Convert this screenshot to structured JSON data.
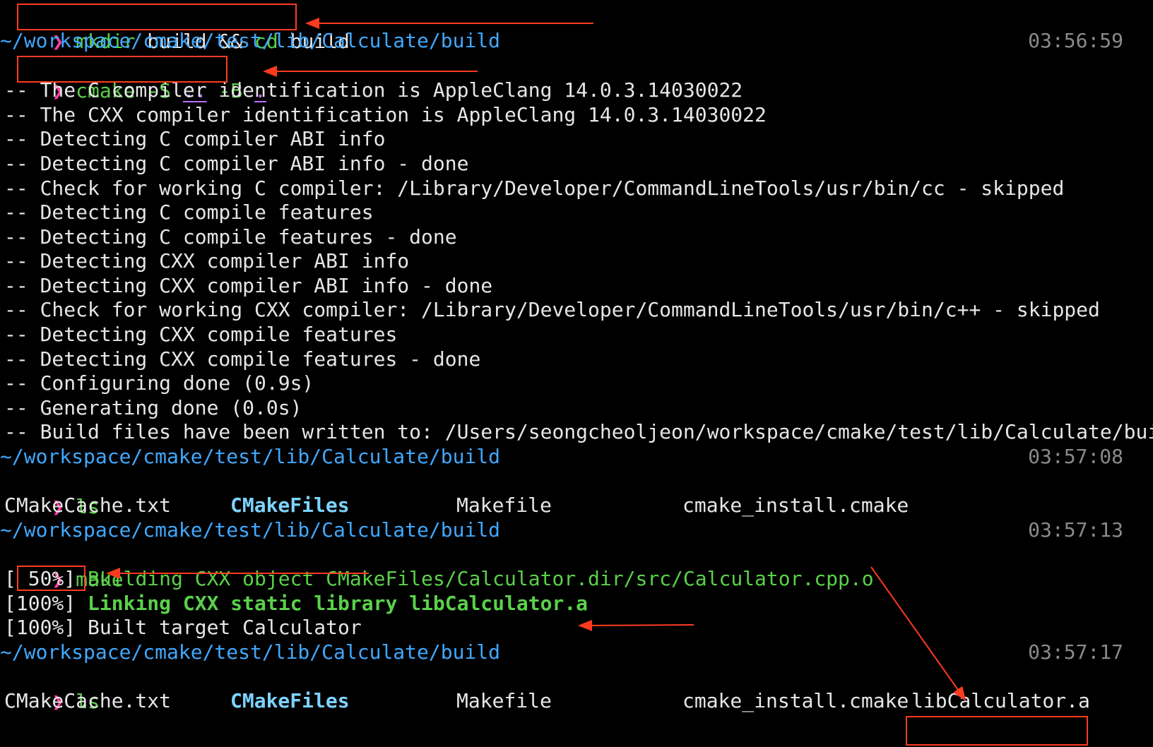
{
  "prompt_symbol": "❯",
  "path_prefix": "~/workspace/cmake/test/lib/Calculate/build",
  "cmd1": {
    "mkdir": "mkdir",
    "a1": " build ",
    "amp": "&&",
    "cd": " cd",
    "a2": " build"
  },
  "time1": "03:56:59",
  "cmd2": {
    "cmake": "cmake",
    "s": " -S ",
    "dotdot": "..",
    "b": " -B ",
    "dot": "."
  },
  "cmake_output": [
    "-- The C compiler identification is AppleClang 14.0.3.14030022",
    "-- The CXX compiler identification is AppleClang 14.0.3.14030022",
    "-- Detecting C compiler ABI info",
    "-- Detecting C compiler ABI info - done",
    "-- Check for working C compiler: /Library/Developer/CommandLineTools/usr/bin/cc - skipped",
    "-- Detecting C compile features",
    "-- Detecting C compile features - done",
    "-- Detecting CXX compiler ABI info",
    "-- Detecting CXX compiler ABI info - done",
    "-- Check for working CXX compiler: /Library/Developer/CommandLineTools/usr/bin/c++ - skipped",
    "-- Detecting CXX compile features",
    "-- Detecting CXX compile features - done",
    "-- Configuring done (0.9s)",
    "-- Generating done (0.0s)",
    "-- Build files have been written to: /Users/seongcheoljeon/workspace/cmake/test/lib/Calculate/build"
  ],
  "time2": "03:57:08",
  "cmd3": "ls",
  "ls1": [
    "CMakeCache.txt",
    "CMakeFiles",
    "Makefile",
    "cmake_install.cmake"
  ],
  "time3": "03:57:13",
  "cmd4": "make",
  "make_output": {
    "l1_pct": "[ 50%] ",
    "l1_text": "Building CXX object CMakeFiles/Calculator.dir/src/Calculator.cpp.o",
    "l2_pct": "[100%] ",
    "l2_text": "Linking CXX static library libCalculator.a",
    "l3": "[100%] Built target Calculator"
  },
  "time4": "03:57:17",
  "cmd5": "ls",
  "ls2": [
    "CMakeCache.txt",
    "CMakeFiles",
    "Makefile",
    "cmake_install.cmake",
    "libCalculator.a"
  ],
  "colors": {
    "prompt": "#ff3fa4",
    "path": "#40a8ff",
    "green": "#5ad14a",
    "annotation": "#ff3b1f"
  }
}
